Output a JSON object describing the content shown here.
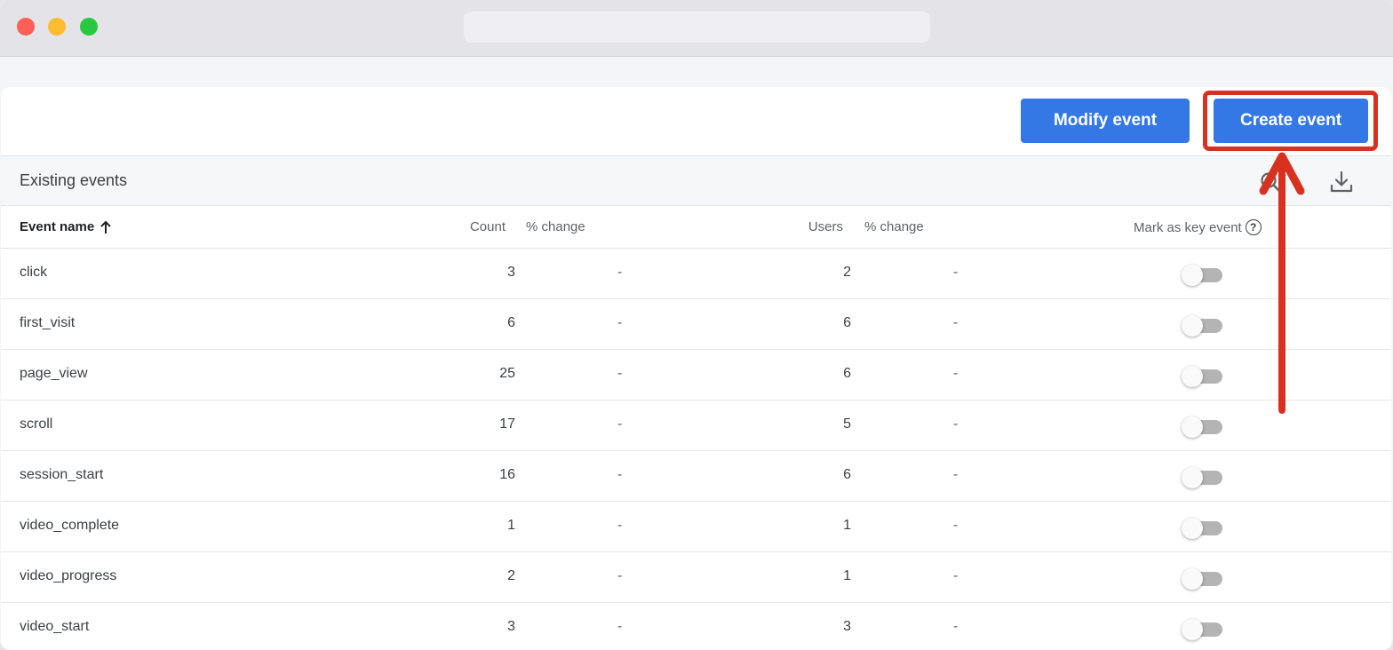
{
  "toolbar": {
    "modify_label": "Modify event",
    "create_label": "Create event"
  },
  "section": {
    "title": "Existing events"
  },
  "columns": {
    "event_name": "Event name",
    "count": "Count",
    "pct_change_1": "% change",
    "users": "Users",
    "pct_change_2": "% change",
    "key_event": "Mark as key event",
    "help": "?"
  },
  "rows": [
    {
      "name": "click",
      "count": "3",
      "count_change": "-",
      "users": "2",
      "users_change": "-",
      "key_event": false
    },
    {
      "name": "first_visit",
      "count": "6",
      "count_change": "-",
      "users": "6",
      "users_change": "-",
      "key_event": false
    },
    {
      "name": "page_view",
      "count": "25",
      "count_change": "-",
      "users": "6",
      "users_change": "-",
      "key_event": false
    },
    {
      "name": "scroll",
      "count": "17",
      "count_change": "-",
      "users": "5",
      "users_change": "-",
      "key_event": false
    },
    {
      "name": "session_start",
      "count": "16",
      "count_change": "-",
      "users": "6",
      "users_change": "-",
      "key_event": false
    },
    {
      "name": "video_complete",
      "count": "1",
      "count_change": "-",
      "users": "1",
      "users_change": "-",
      "key_event": false
    },
    {
      "name": "video_progress",
      "count": "2",
      "count_change": "-",
      "users": "1",
      "users_change": "-",
      "key_event": false
    },
    {
      "name": "video_start",
      "count": "3",
      "count_change": "-",
      "users": "3",
      "users_change": "-",
      "key_event": false
    }
  ],
  "icons": {
    "sort": "arrow-up-icon",
    "search": "search-icon",
    "download": "download-icon",
    "help": "help-circle-icon"
  },
  "colors": {
    "button": "#3478e6",
    "annotation": "#d9311f"
  }
}
